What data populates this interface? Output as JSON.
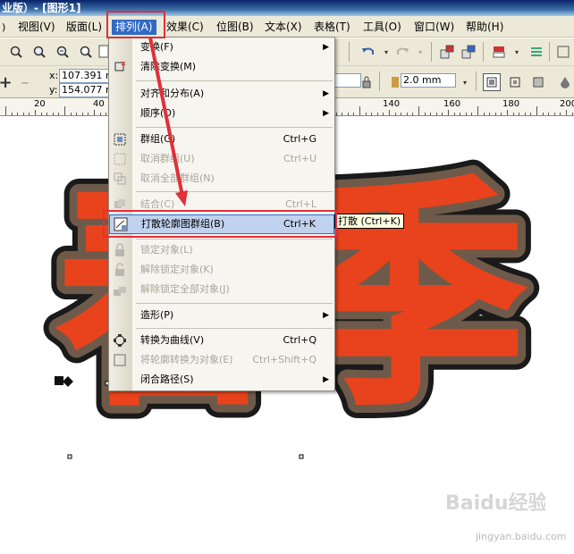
{
  "window": {
    "title": "业版）- [图形1]"
  },
  "menubar": {
    "items": [
      {
        "label": "视图(V)"
      },
      {
        "label": "版面(L)"
      },
      {
        "label": "排列(A)"
      },
      {
        "label": "效果(C)"
      },
      {
        "label": "位图(B)"
      },
      {
        "label": "文本(X)"
      },
      {
        "label": "表格(T)"
      },
      {
        "label": "工具(O)"
      },
      {
        "label": "窗口(W)"
      },
      {
        "label": "帮助(H)"
      }
    ]
  },
  "toolbar2": {
    "x_label": "x:",
    "y_label": "y:",
    "x_value": "107.391 m",
    "y_value": "154.077 m",
    "outline_width": "2.0 mm"
  },
  "ruler": {
    "labels": [
      "20",
      "40",
      "140",
      "160",
      "180",
      "200"
    ]
  },
  "arrange_menu": {
    "items": [
      {
        "label": "变换(F)",
        "shortcut": "",
        "submenu": true,
        "disabled": false,
        "icon": ""
      },
      {
        "label": "清除变换(M)",
        "shortcut": "",
        "submenu": false,
        "disabled": false,
        "icon": "clear-transform-icon"
      },
      {
        "label": "对齐和分布(A)",
        "shortcut": "",
        "submenu": true,
        "disabled": false,
        "icon": ""
      },
      {
        "label": "顺序(O)",
        "shortcut": "",
        "submenu": true,
        "disabled": false,
        "icon": ""
      },
      {
        "label": "群组(G)",
        "shortcut": "Ctrl+G",
        "submenu": false,
        "disabled": false,
        "icon": "group-icon"
      },
      {
        "label": "取消群组(U)",
        "shortcut": "Ctrl+U",
        "submenu": false,
        "disabled": true,
        "icon": "ungroup-icon"
      },
      {
        "label": "取消全部群组(N)",
        "shortcut": "",
        "submenu": false,
        "disabled": true,
        "icon": "ungroup-all-icon"
      },
      {
        "label": "结合(C)",
        "shortcut": "Ctrl+L",
        "submenu": false,
        "disabled": true,
        "icon": "combine-icon"
      },
      {
        "label": "打散轮廓图群组(B)",
        "shortcut": "Ctrl+K",
        "submenu": false,
        "disabled": false,
        "icon": "break-apart-icon"
      },
      {
        "label": "锁定对象(L)",
        "shortcut": "",
        "submenu": false,
        "disabled": true,
        "icon": "lock-icon"
      },
      {
        "label": "解除锁定对象(K)",
        "shortcut": "",
        "submenu": false,
        "disabled": true,
        "icon": "unlock-icon"
      },
      {
        "label": "解除锁定全部对象(J)",
        "shortcut": "",
        "submenu": false,
        "disabled": true,
        "icon": "unlock-all-icon"
      },
      {
        "label": "造形(P)",
        "shortcut": "",
        "submenu": true,
        "disabled": false,
        "icon": ""
      },
      {
        "label": "转换为曲线(V)",
        "shortcut": "Ctrl+Q",
        "submenu": false,
        "disabled": false,
        "icon": "convert-to-curves-icon"
      },
      {
        "label": "将轮廓转换为对象(E)",
        "shortcut": "Ctrl+Shift+Q",
        "submenu": false,
        "disabled": true,
        "icon": "outline-to-object-icon"
      },
      {
        "label": "闭合路径(S)",
        "shortcut": "",
        "submenu": true,
        "disabled": false,
        "icon": ""
      }
    ]
  },
  "tooltip": "打散 (Ctrl+K)",
  "artwork": {
    "text": "春季",
    "fill_color": "#e8431c",
    "inner_outline_color": "#6e5a4a",
    "outer_outline_color": "#1a1a1a"
  },
  "annotation_color": "#e0303a",
  "watermark": {
    "logo": "Baidu经验",
    "url": "jingyan.baidu.com"
  }
}
